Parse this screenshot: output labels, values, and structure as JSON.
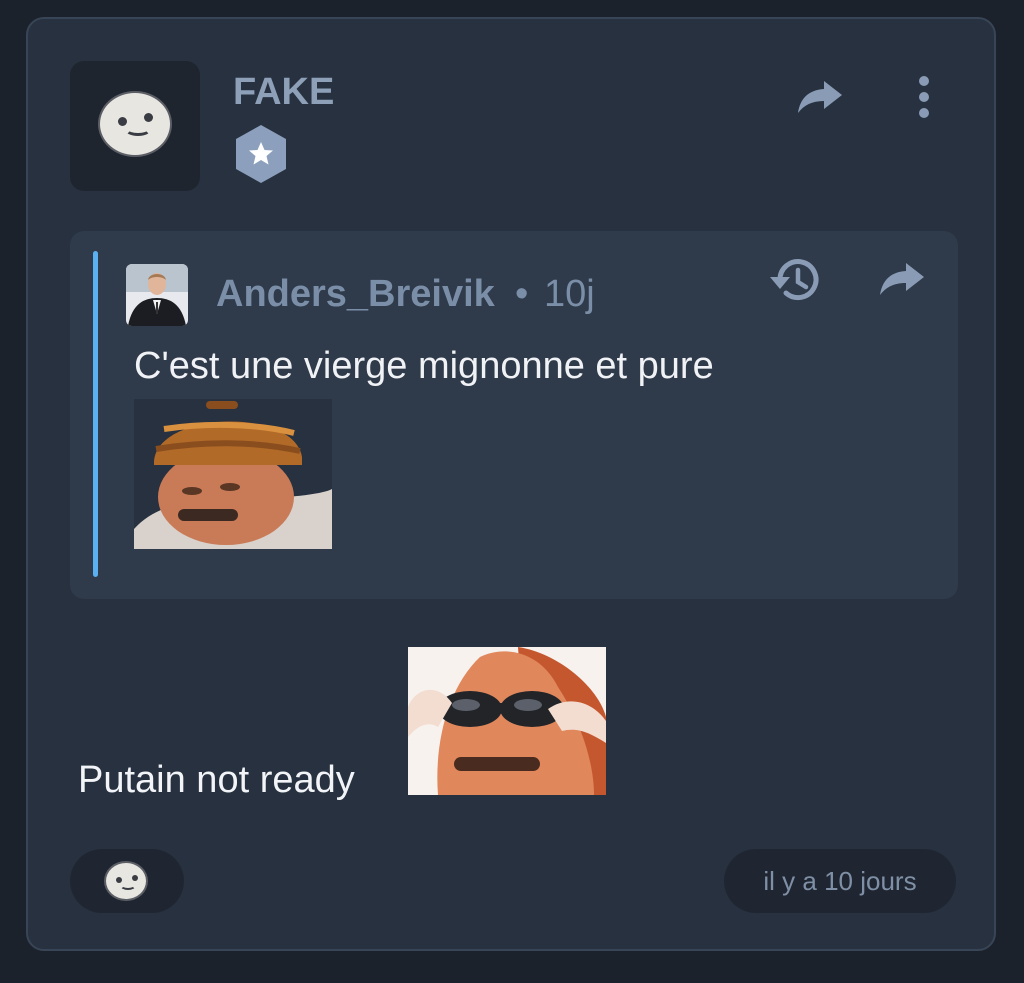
{
  "post": {
    "username": "FAKE",
    "badge_icon": "star-hexagon-icon",
    "actions": {
      "share_icon": "share-arrow-icon",
      "menu_icon": "vertical-dots-icon"
    },
    "quote": {
      "author": "Anders_Breivik",
      "separator": "•",
      "time": "10j",
      "text": "C'est une vierge mignonne et pure",
      "sticker": "risitas-bonnet-sticker",
      "actions": {
        "history_icon": "history-icon",
        "share_icon": "share-arrow-icon"
      }
    },
    "text": "Putain not ready",
    "sticker": "risitas-sunglasses-sticker",
    "footer": {
      "reaction_icon": "smiley-icon",
      "timestamp": "il y a 10 jours"
    }
  },
  "colors": {
    "background": "#1c222b",
    "card": "#27313f",
    "quote_bg": "#2f3a4a",
    "quote_bar": "#5ab0f0",
    "username": "#8ea0b8"
  }
}
